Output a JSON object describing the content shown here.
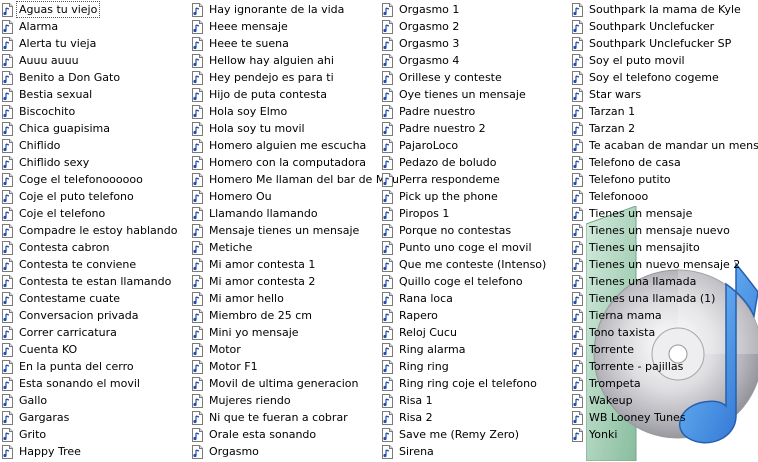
{
  "selected_index": 0,
  "icons": {
    "file": "audio-file-icon",
    "decoration": "music-cd-icon"
  },
  "columns": [
    [
      "Aguas tu viejo",
      "Alarma",
      "Alerta tu vieja",
      "Auuu auuu",
      "Benito a Don Gato",
      "Bestia sexual",
      "Biscochito",
      "Chica guapisima",
      "Chiflido",
      "Chiflido sexy",
      "Coge el telefonoooooo",
      "Coje el puto telefono",
      "Coje el telefono",
      "Compadre le estoy hablando",
      "Contesta cabron",
      "Contesta te conviene",
      "Contesta te estan llamando",
      "Contestame cuate",
      "Conversacion privada",
      "Correr carricatura",
      "Cuenta KO",
      "En la punta del cerro",
      "Esta sonando el movil",
      "Gallo",
      "Gargaras",
      "Grito",
      "Happy Tree"
    ],
    [
      "Hay ignorante de la vida",
      "Heee mensaje",
      "Heee te suena",
      "Hellow hay alguien ahi",
      "Hey pendejo es para ti",
      "Hijo de puta contesta",
      "Hola soy Elmo",
      "Hola soy tu movil",
      "Homero alguien me escucha",
      "Homero con la computadora",
      "Homero Me llaman del bar de Mou",
      "Homero Ou",
      "Llamando llamando",
      "Mensaje tienes un mensaje",
      "Metiche",
      "Mi amor contesta 1",
      "Mi amor contesta 2",
      "Mi amor hello",
      "Miembro de 25 cm",
      "Mini yo mensaje",
      "Motor",
      "Motor F1",
      "Movil de ultima generacion",
      "Mujeres riendo",
      "Ni que te fueran a cobrar",
      "Orale esta sonando",
      "Orgasmo"
    ],
    [
      "Orgasmo 1",
      "Orgasmo 2",
      "Orgasmo 3",
      "Orgasmo 4",
      "Orillese y conteste",
      "Oye tienes un mensaje",
      "Padre nuestro",
      "Padre nuestro 2",
      "PajaroLoco",
      "Pedazo de boludo",
      "Perra respondeme",
      "Pick up the phone",
      "Piropos 1",
      "Porque no contestas",
      "Punto uno coge el movil",
      "Que me conteste (Intenso)",
      "Quillo coge el telefono",
      "Rana loca",
      "Rapero",
      "Reloj Cucu",
      "Ring alarma",
      "Ring ring",
      "Ring ring coje el telefono",
      "Risa 1",
      "Risa 2",
      "Save me (Remy Zero)",
      "Sirena"
    ],
    [
      "Southpark la mama de Kyle",
      "Southpark Unclefucker",
      "Southpark Unclefucker SP",
      "Soy el puto movil",
      "Soy el telefono cogeme",
      "Star wars",
      "Tarzan 1",
      "Tarzan 2",
      "Te acaban de mandar un mensaje",
      "Telefono de casa",
      "Telefono putito",
      "Telefonooo",
      "Tienes un mensaje",
      "Tienes un mensaje nuevo",
      "Tienes un mensajito",
      "Tienes un nuevo mensaje 2",
      "Tienes una llamada",
      "Tienes una llamada (1)",
      "Tierna mama",
      "Tono taxista",
      "Torrente",
      "Torrente - pajillas",
      "Trompeta",
      "Wakeup",
      "WB Looney Tunes",
      "Yonki"
    ]
  ]
}
